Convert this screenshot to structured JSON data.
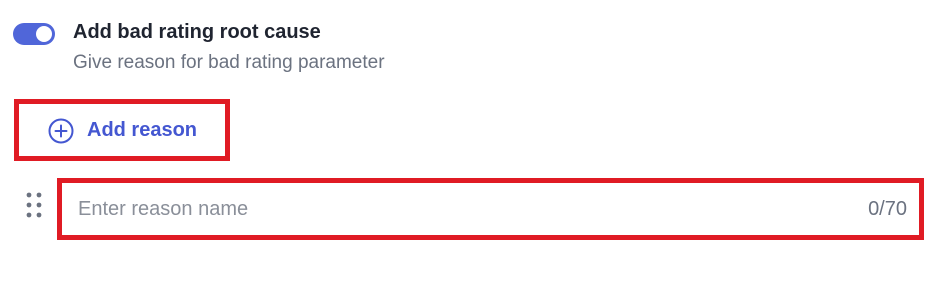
{
  "setting": {
    "toggle_on": true,
    "title": "Add bad rating root cause",
    "subtitle": "Give reason for bad rating parameter"
  },
  "add_reason": {
    "label": "Add reason",
    "icon": "plus-circle-icon"
  },
  "reason_field": {
    "placeholder": "Enter reason name",
    "value": "",
    "counter": "0/70"
  },
  "colors": {
    "accent": "#4457d1",
    "toggle": "#5066d9",
    "highlight": "#e01b24"
  }
}
